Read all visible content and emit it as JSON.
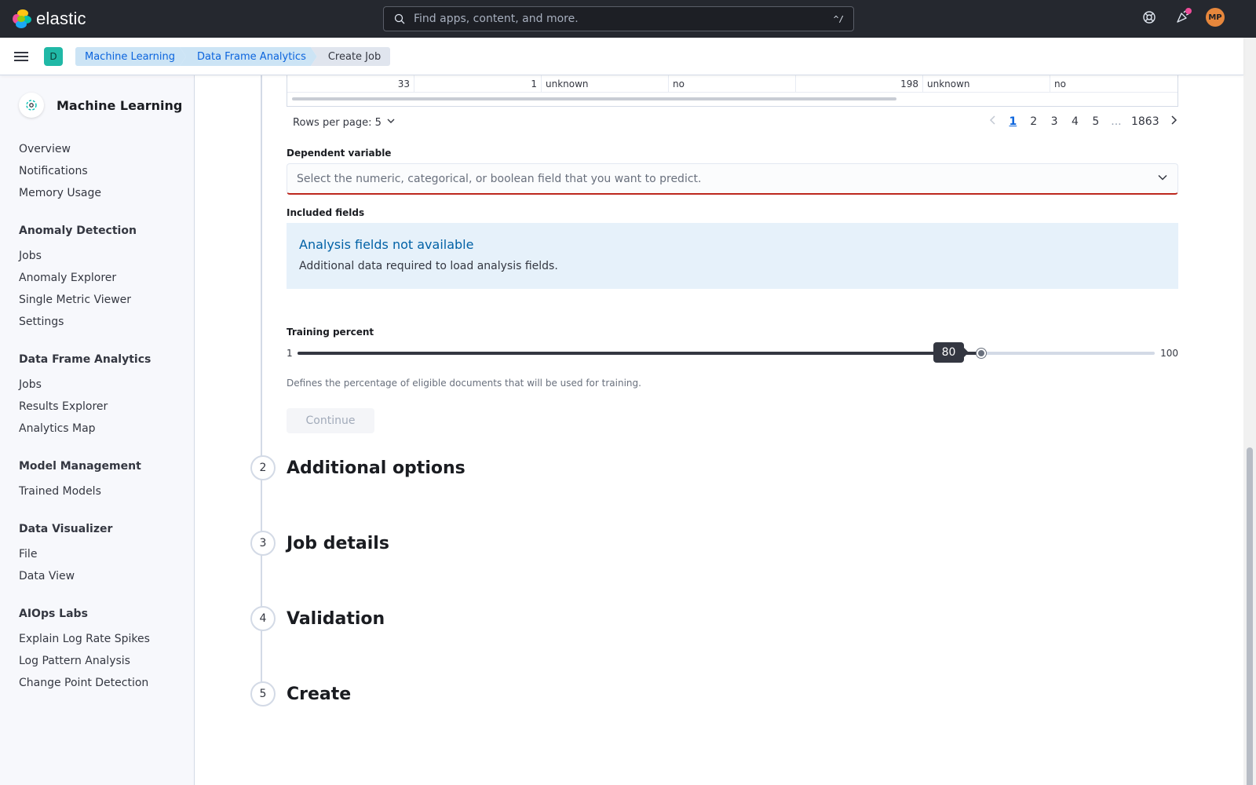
{
  "header": {
    "brand": "elastic",
    "search_placeholder": "Find apps, content, and more.",
    "search_shortcut": "^/",
    "avatar_initials": "MP"
  },
  "breadcrumbs": {
    "space_letter": "D",
    "items": [
      "Machine Learning",
      "Data Frame Analytics",
      "Create Job"
    ]
  },
  "sidebar": {
    "title": "Machine Learning",
    "top_items": [
      "Overview",
      "Notifications",
      "Memory Usage"
    ],
    "groups": [
      {
        "title": "Anomaly Detection",
        "items": [
          "Jobs",
          "Anomaly Explorer",
          "Single Metric Viewer",
          "Settings"
        ]
      },
      {
        "title": "Data Frame Analytics",
        "items": [
          "Jobs",
          "Results Explorer",
          "Analytics Map"
        ]
      },
      {
        "title": "Model Management",
        "items": [
          "Trained Models"
        ]
      },
      {
        "title": "Data Visualizer",
        "items": [
          "File",
          "Data View"
        ]
      },
      {
        "title": "AIOps Labs",
        "items": [
          "Explain Log Rate Spikes",
          "Log Pattern Analysis",
          "Change Point Detection"
        ]
      }
    ]
  },
  "table": {
    "row": [
      "33",
      "1",
      "unknown",
      "no",
      "",
      "198",
      "unknown",
      "no",
      ""
    ]
  },
  "pagination": {
    "rows_per_page": "Rows per page: 5",
    "pages": [
      "1",
      "2",
      "3",
      "4",
      "5"
    ],
    "ellipsis": "...",
    "last_page": "1863",
    "active_page": "1"
  },
  "form": {
    "dependent_variable_label": "Dependent variable",
    "dependent_variable_placeholder": "Select the numeric, categorical, or boolean field that you want to predict.",
    "included_fields_label": "Included fields",
    "callout_title": "Analysis fields not available",
    "callout_body": "Additional data required to load analysis fields.",
    "training_percent_label": "Training percent",
    "training_min": "1",
    "training_max": "100",
    "training_value": "80",
    "training_help": "Defines the percentage of eligible documents that will be used for training.",
    "continue_label": "Continue"
  },
  "steps": [
    {
      "num": "2",
      "title": "Additional options"
    },
    {
      "num": "3",
      "title": "Job details"
    },
    {
      "num": "4",
      "title": "Validation"
    },
    {
      "num": "5",
      "title": "Create"
    }
  ],
  "colors": {
    "header_bg": "#25282f",
    "accent": "#0b64dd",
    "error": "#bd271e",
    "callout_bg": "#e6f1fa"
  }
}
